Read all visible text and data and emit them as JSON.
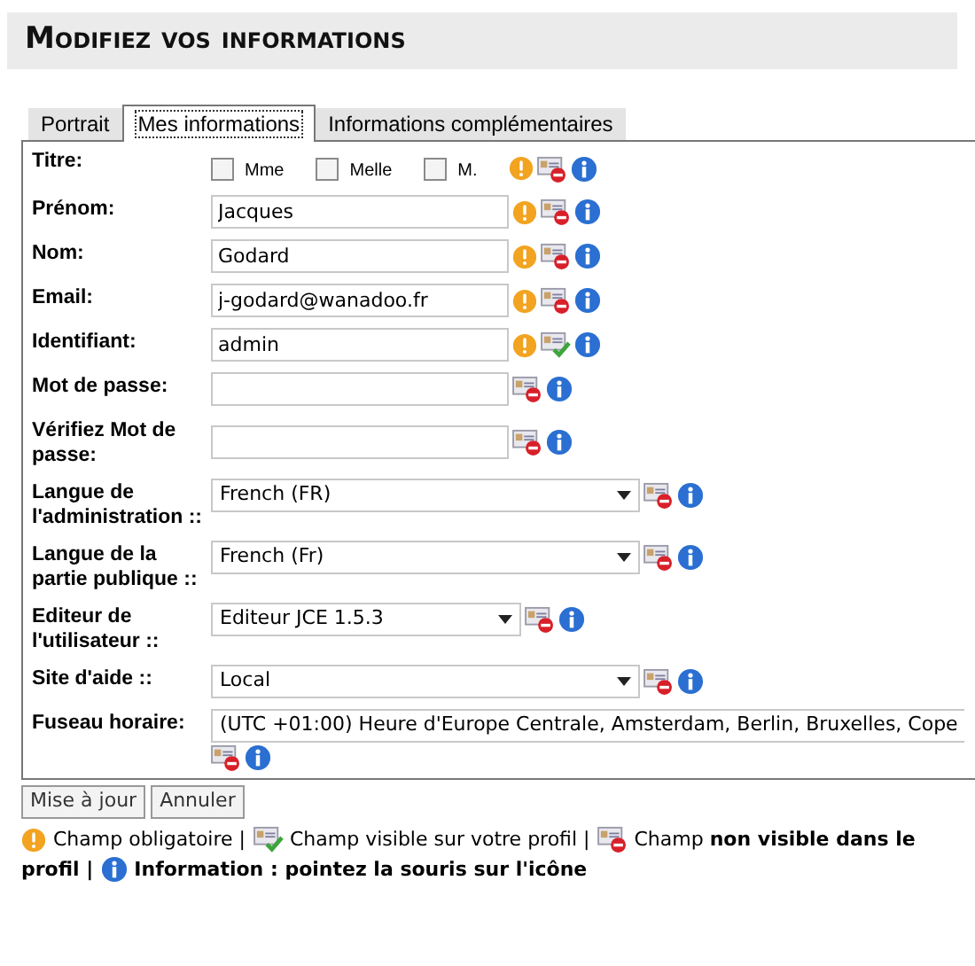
{
  "title": "Modifiez vos informations",
  "tabs": [
    {
      "label": "Portrait",
      "selected": false
    },
    {
      "label": "Mes informations",
      "selected": true
    },
    {
      "label": "Informations complémentaires",
      "selected": false
    }
  ],
  "fields": [
    {
      "kind": "checkboxes",
      "label": "Titre:",
      "options": [
        {
          "label": "Mme",
          "checked": false
        },
        {
          "label": "Melle",
          "checked": false
        },
        {
          "label": "M.",
          "checked": false
        }
      ],
      "required": true,
      "public": false
    },
    {
      "kind": "text",
      "label": "Prénom:",
      "value": "Jacques",
      "required": true,
      "public": false
    },
    {
      "kind": "text",
      "label": "Nom:",
      "value": "Godard",
      "required": true,
      "public": false
    },
    {
      "kind": "text",
      "label": "Email:",
      "value": "j-godard@wanadoo.fr",
      "required": true,
      "public": false
    },
    {
      "kind": "text",
      "label": "Identifiant:",
      "value": "admin",
      "required": true,
      "public": true
    },
    {
      "kind": "text",
      "label": "Mot de passe:",
      "required": false,
      "public": false
    },
    {
      "kind": "text",
      "label": "Vérifiez Mot de passe:",
      "required": false,
      "public": false
    },
    {
      "kind": "select",
      "label": "Langue de l'administration ::",
      "value": "French (FR)",
      "required": false,
      "public": false
    },
    {
      "kind": "select",
      "label": "Langue de la partie publique ::",
      "value": "French (Fr)",
      "required": false,
      "public": false
    },
    {
      "kind": "short-select",
      "label": "Editeur de l'utilisateur ::",
      "value": "Editeur JCE 1.5.3",
      "required": false,
      "public": false
    },
    {
      "kind": "select",
      "label": "Site d'aide ::",
      "value": "Local",
      "required": false,
      "public": false
    },
    {
      "kind": "wide-select",
      "label": "Fuseau horaire:",
      "value": "(UTC +01:00) Heure d'Europe Centrale, Amsterdam, Berlin, Bruxelles, Cope",
      "required": false,
      "public": false
    }
  ],
  "buttons": [
    "Mise à jour",
    "Annuler"
  ],
  "legend": [
    {
      "kind": "required",
      "text": "Champ obligatoire |",
      "bold": false
    },
    {
      "kind": "visible",
      "text": "Champ visible sur votre profil |",
      "bold": false
    },
    {
      "kind": "hidden",
      "text": "Champ **non visible dans le**",
      "bold": false
    },
    {
      "kind": "plain",
      "text": "profil |",
      "bold": true
    },
    {
      "kind": "info",
      "text": "Information : pointez la souris sur l'icône",
      "bold": true
    }
  ]
}
